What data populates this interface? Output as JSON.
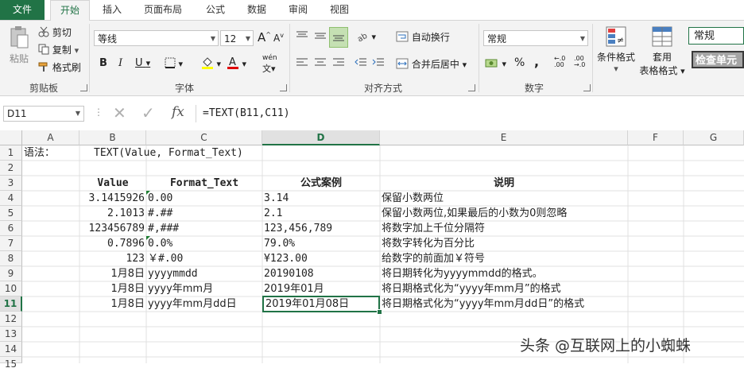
{
  "tabs": [
    "文件",
    "开始",
    "插入",
    "页面布局",
    "公式",
    "数据",
    "审阅",
    "视图"
  ],
  "ribbon": {
    "clipboard": {
      "paste": "粘贴",
      "cut": "剪切",
      "copy": "复制",
      "format_painter": "格式刷",
      "label": "剪贴板"
    },
    "font": {
      "name": "等线",
      "size": "12",
      "bold": "B",
      "italic": "I",
      "underline": "U",
      "grow": "A",
      "shrink": "A",
      "label": "字体",
      "wen": "wén"
    },
    "alignment": {
      "wrap": "自动换行",
      "merge": "合并后居中",
      "label": "对齐方式"
    },
    "number": {
      "format": "常规",
      "percent": "%",
      "comma": ",",
      "label": "数字"
    },
    "styles": {
      "conditional": "条件格式",
      "table_line1": "套用",
      "table_line2": "表格格式",
      "style_normal": "常规",
      "style_check": "检查单元"
    }
  },
  "formula_bar": {
    "name_box": "D11",
    "fx": "fx",
    "formula": "=TEXT(B11,C11)"
  },
  "columns": [
    "A",
    "B",
    "C",
    "D",
    "E",
    "F",
    "G"
  ],
  "rows": [
    "1",
    "2",
    "3",
    "4",
    "5",
    "6",
    "7",
    "8",
    "9",
    "10",
    "11",
    "12",
    "13",
    "14",
    "15"
  ],
  "selected": {
    "column": "D",
    "row": "11"
  },
  "cells": {
    "a1": "语法：",
    "b1": "TEXT(Value, Format_Text)",
    "b3": "Value",
    "c3": "Format_Text",
    "d3": "公式案例",
    "e3": "说明",
    "b4": "3.1415926",
    "c4": "0.00",
    "d4": "3.14",
    "e4": "保留小数两位",
    "b5": "2.1013",
    "c5": "#.##",
    "d5": "2.1",
    "e5": "保留小数两位,如果最后的小数为0则忽略",
    "b6": "123456789",
    "c6": "#,###",
    "d6": "123,456,789",
    "e6": "将数字加上千位分隔符",
    "b7": "0.7896",
    "c7": "0.0%",
    "d7": "79.0%",
    "e7": "将数字转化为百分比",
    "b8": "123",
    "c8": "￥#.00",
    "d8": "¥123.00",
    "e8": "给数字的前面加￥符号",
    "b9": "1月8日",
    "c9": "yyyymmdd",
    "d9": "20190108",
    "e9": "将日期转化为yyyymmdd的格式。",
    "b10": "1月8日",
    "c10": "yyyy年mm月",
    "d10": "2019年01月",
    "e10": "将日期格式化为“yyyy年mm月”的格式",
    "b11": "1月8日",
    "c11": "yyyy年mm月dd日",
    "d11": "2019年01月08日",
    "e11": "将日期格式化为“yyyy年mm月dd日”的格式"
  },
  "watermark": "头条 @互联网上的小蜘蛛",
  "colors": {
    "excel_green": "#217346",
    "ribbon_bg": "#f3f3f3"
  }
}
